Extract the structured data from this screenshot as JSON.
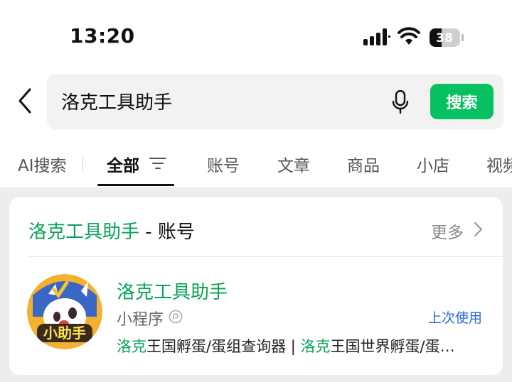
{
  "status": {
    "time": "13:20",
    "battery": "38"
  },
  "search": {
    "query": "洛克工具助手",
    "button_label": "搜索"
  },
  "tabs": [
    {
      "label": "AI搜索"
    },
    {
      "label": "全部",
      "active": true
    },
    {
      "label": "账号"
    },
    {
      "label": "文章"
    },
    {
      "label": "商品"
    },
    {
      "label": "小店"
    },
    {
      "label": "视频"
    }
  ],
  "section": {
    "title_highlight": "洛克工具助手",
    "title_suffix": " - 账号",
    "more_label": "更多"
  },
  "result": {
    "name": "洛克工具助手",
    "type": "小程序",
    "badge": "上次使用",
    "avatar_text": "小助手",
    "desc_parts": [
      {
        "text": "洛克",
        "highlight": true
      },
      {
        "text": "王国孵蛋/蛋组查询器 | ",
        "highlight": false
      },
      {
        "text": "洛克",
        "highlight": true
      },
      {
        "text": "王国世界孵蛋/蛋…",
        "highlight": false
      }
    ]
  },
  "colors": {
    "accent": "#07c160",
    "highlight_text": "#07a456",
    "link_blue": "#2a6bd6"
  }
}
